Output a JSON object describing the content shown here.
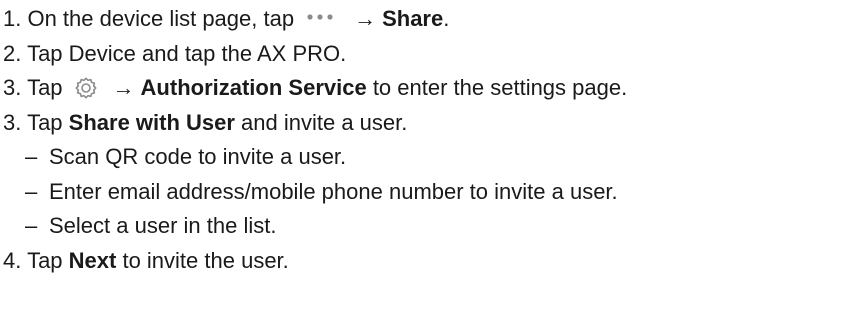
{
  "steps": {
    "step1": {
      "prefix": "1. On the device list page, tap",
      "icon": "more-dots-icon",
      "arrow": "→",
      "bold": "Share",
      "suffix": "."
    },
    "step2": {
      "text": "2. Tap Device and tap the AX PRO."
    },
    "step3a": {
      "prefix": "3. Tap",
      "icon": "gear-icon",
      "arrow": "→",
      "bold": "Authorization Service",
      "suffix": " to enter the settings page."
    },
    "step3b": {
      "prefix": "3. Tap ",
      "bold": "Share with User",
      "suffix": " and invite a user."
    },
    "sub_items": [
      {
        "dash": "–",
        "text": "Scan QR code to invite a user."
      },
      {
        "dash": "–",
        "text": "Enter email address/mobile phone number to invite a user."
      },
      {
        "dash": "–",
        "text": "Select a user in the list."
      }
    ],
    "step4": {
      "prefix": "4. Tap ",
      "bold": "Next",
      "suffix": " to invite the user."
    }
  },
  "colors": {
    "text": "#1a1a1a",
    "icon": "#8c8c8c"
  }
}
